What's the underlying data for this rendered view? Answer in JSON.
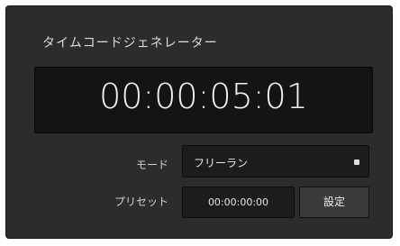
{
  "panel": {
    "title": "タイムコードジェネレーター"
  },
  "timecode": {
    "value": "00:00:05:01"
  },
  "mode": {
    "label": "モード",
    "selected": "フリーラン",
    "icon": "dropdown-arrow-icon"
  },
  "preset": {
    "label": "プリセット",
    "value": "00:00:00:00",
    "button_label": "設定"
  },
  "colors": {
    "panel_background": "#2c2c2c",
    "display_background": "#141414",
    "field_background": "#1c1c1c",
    "button_background": "#3a3a3a",
    "text": "#f2f2f2"
  }
}
